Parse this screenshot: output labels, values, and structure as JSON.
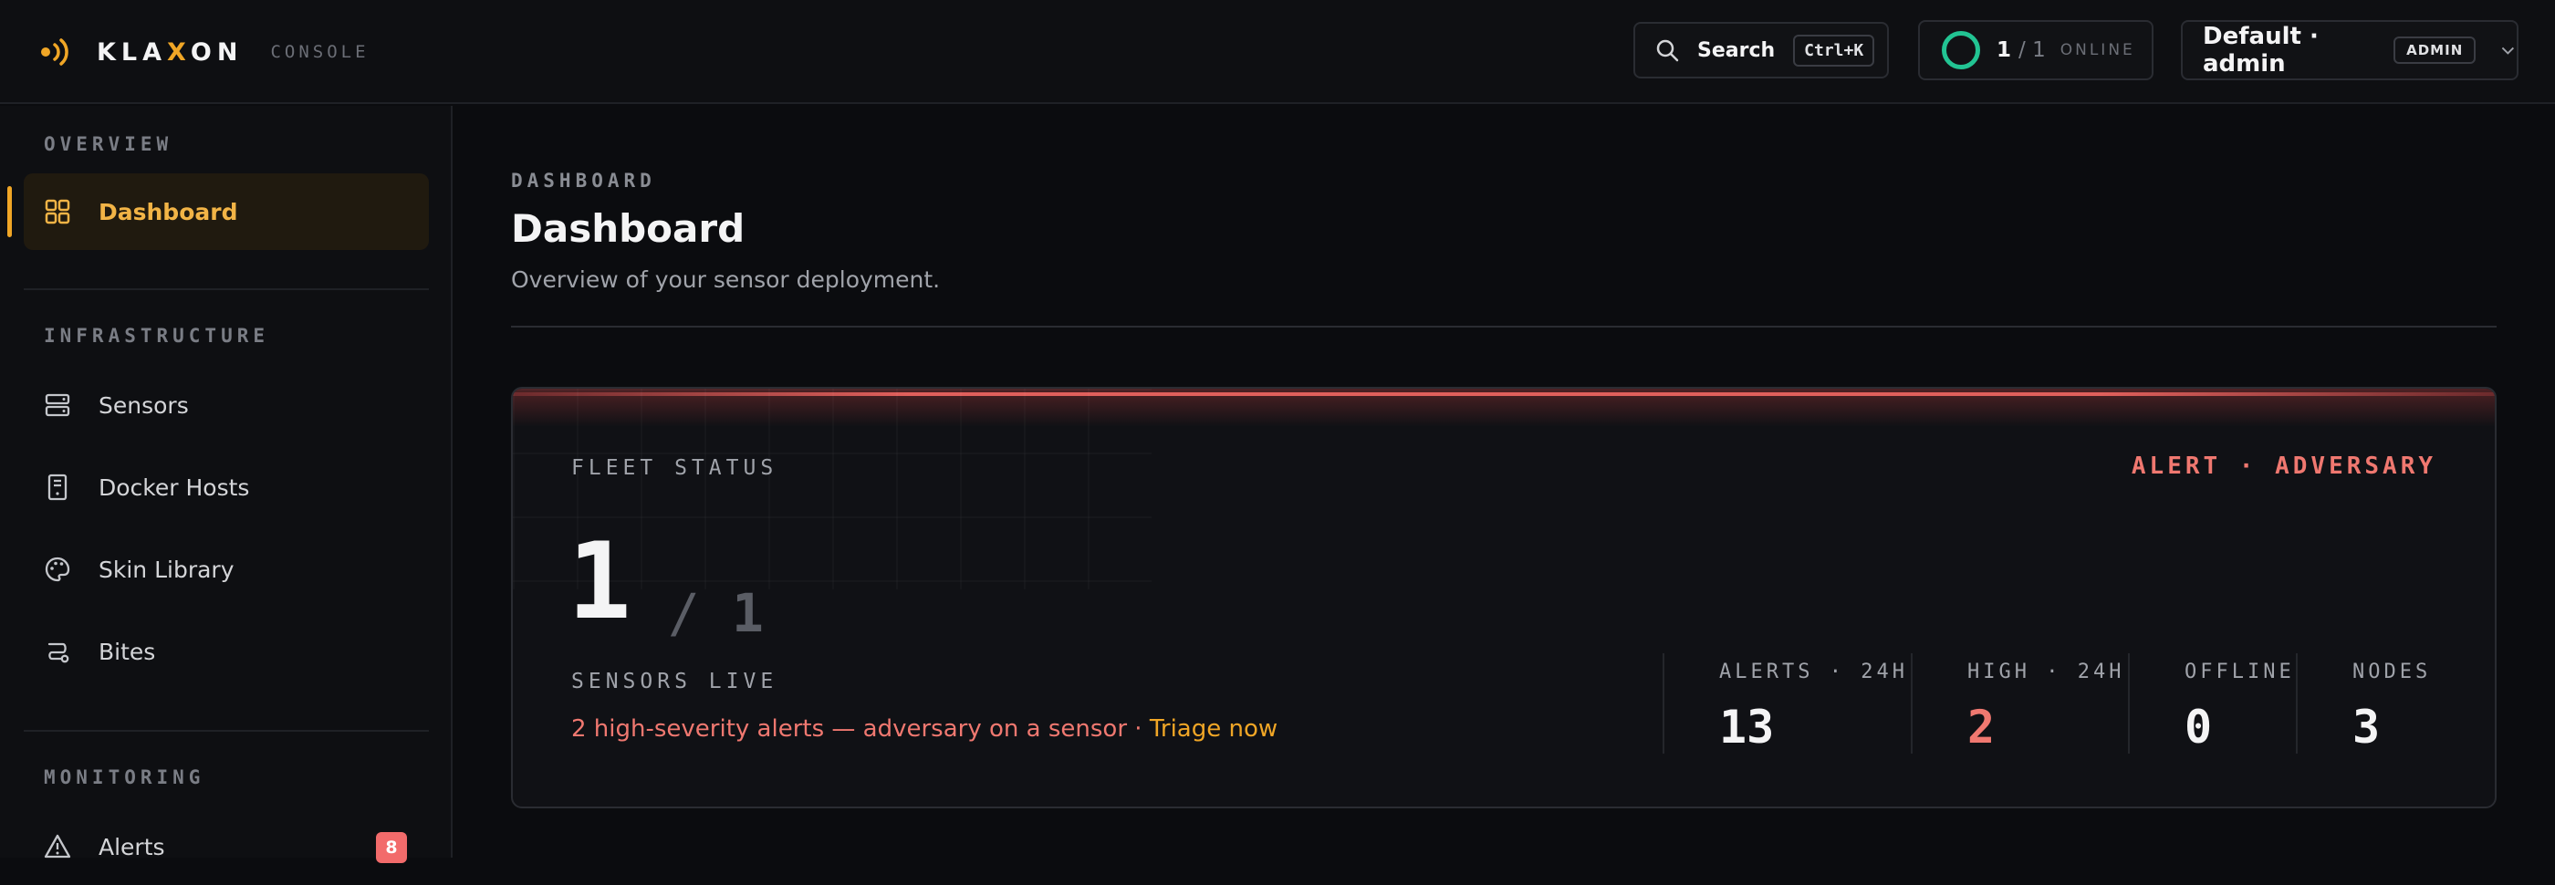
{
  "brand": {
    "name_pre": "KLA",
    "name_accent": "X",
    "name_post": "ON",
    "sub": "CONSOLE"
  },
  "topbar": {
    "search_label": "Search",
    "search_shortcut": "Ctrl+K",
    "online_live": "1",
    "online_total": "1",
    "online_label": "ONLINE",
    "user_name": "Default · admin",
    "user_role": "ADMIN"
  },
  "sidebar": {
    "sections": [
      {
        "label": "OVERVIEW",
        "items": [
          {
            "label": "Dashboard",
            "icon": "grid-icon",
            "active": true
          }
        ]
      },
      {
        "label": "INFRASTRUCTURE",
        "items": [
          {
            "label": "Sensors",
            "icon": "server-icon"
          },
          {
            "label": "Docker Hosts",
            "icon": "host-icon"
          },
          {
            "label": "Skin Library",
            "icon": "palette-icon"
          },
          {
            "label": "Bites",
            "icon": "route-icon"
          }
        ]
      },
      {
        "label": "MONITORING",
        "items": [
          {
            "label": "Alerts",
            "icon": "warning-icon",
            "badge": "8"
          }
        ]
      }
    ]
  },
  "main": {
    "breadcrumb": "DASHBOARD",
    "title": "Dashboard",
    "subtitle": "Overview of your sensor deployment."
  },
  "fleet": {
    "label": "FLEET STATUS",
    "status": "ALERT · ADVERSARY",
    "live": "1",
    "separator": "/",
    "total": "1",
    "live_label": "SENSORS LIVE",
    "alert_text": "2 high-severity alerts — adversary on a sensor · ",
    "triage_link": "Triage now",
    "stats": [
      {
        "label": "ALERTS · 24H",
        "value": "13"
      },
      {
        "label": "HIGH · 24H",
        "value": "2"
      },
      {
        "label": "OFFLINE",
        "value": "0"
      },
      {
        "label": "NODES",
        "value": "3"
      }
    ]
  },
  "colors": {
    "accent": "#f0a626",
    "alert": "#f07870",
    "online": "#22c493",
    "background": "#0b0c0f"
  }
}
